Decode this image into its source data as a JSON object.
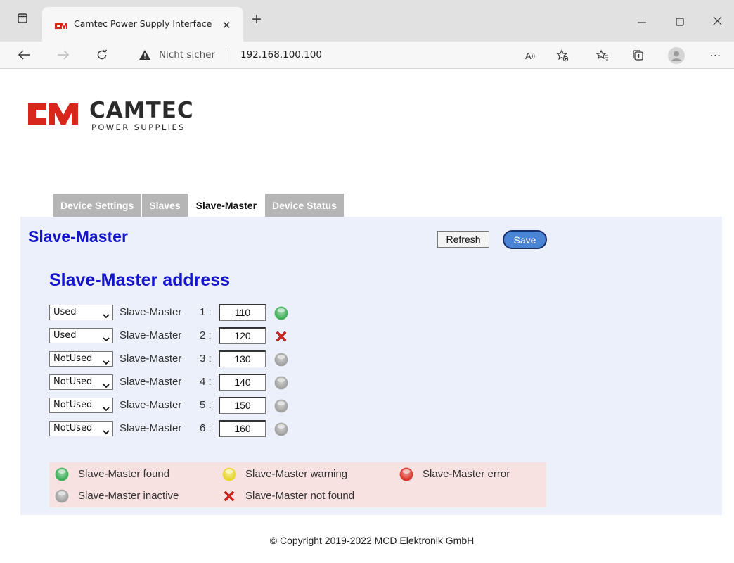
{
  "browser": {
    "tab_title": "Camtec Power Supply Interface",
    "security_label": "Nicht sicher",
    "url": "192.168.100.100"
  },
  "logo": {
    "word": "CAMTEC",
    "sub": "POWER SUPPLIES",
    "brand_color": "#d8261c"
  },
  "nav_tabs": [
    {
      "label": "Device Settings",
      "active": false
    },
    {
      "label": "Slaves",
      "active": false
    },
    {
      "label": "Slave-Master",
      "active": true
    },
    {
      "label": "Device Status",
      "active": false
    }
  ],
  "panel": {
    "title": "Slave-Master",
    "refresh_label": "Refresh",
    "save_label": "Save",
    "section_title": "Slave-Master address"
  },
  "rows": [
    {
      "select": "Used",
      "label": "Slave-Master",
      "num": "1 :",
      "address": "110",
      "status": "found"
    },
    {
      "select": "Used",
      "label": "Slave-Master",
      "num": "2 :",
      "address": "120",
      "status": "not-found"
    },
    {
      "select": "NotUsed",
      "label": "Slave-Master",
      "num": "3 :",
      "address": "130",
      "status": "inactive"
    },
    {
      "select": "NotUsed",
      "label": "Slave-Master",
      "num": "4 :",
      "address": "140",
      "status": "inactive"
    },
    {
      "select": "NotUsed",
      "label": "Slave-Master",
      "num": "5 :",
      "address": "150",
      "status": "inactive"
    },
    {
      "select": "NotUsed",
      "label": "Slave-Master",
      "num": "6 :",
      "address": "160",
      "status": "inactive"
    }
  ],
  "legend": [
    {
      "status": "found",
      "label": "Slave-Master found"
    },
    {
      "status": "warning",
      "label": "Slave-Master warning"
    },
    {
      "status": "error",
      "label": "Slave-Master error"
    },
    {
      "status": "inactive",
      "label": "Slave-Master inactive"
    },
    {
      "status": "not-found",
      "label": "Slave-Master not found"
    }
  ],
  "colors": {
    "found": "#2fa84a",
    "warning": "#e6d21e",
    "error": "#d9251c",
    "inactive": "#9a9a9a",
    "not-found": "#d9251c"
  },
  "copyright": "© Copyright 2019-2022 MCD Elektronik GmbH"
}
